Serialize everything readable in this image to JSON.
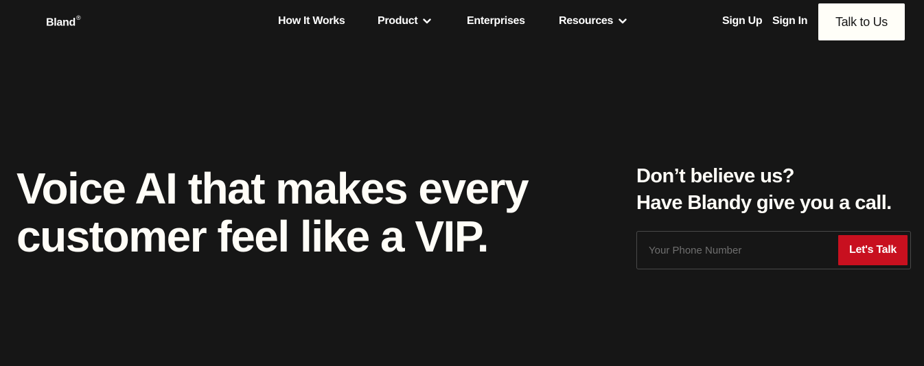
{
  "header": {
    "logo_text": "Bland",
    "logo_mark": "®",
    "nav": [
      {
        "label": "How It Works",
        "has_dropdown": false
      },
      {
        "label": "Product",
        "has_dropdown": true
      },
      {
        "label": "Enterprises",
        "has_dropdown": false
      },
      {
        "label": "Resources",
        "has_dropdown": true
      }
    ],
    "sign_up": "Sign Up",
    "sign_in": "Sign In",
    "cta": "Talk to Us"
  },
  "hero": {
    "title_line1": "Voice AI that makes every",
    "title_line2": "customer feel like a VIP."
  },
  "callout": {
    "line1": "Don’t believe us?",
    "line2": "Have Blandy give you a call.",
    "input_placeholder": "Your Phone Number",
    "input_value": "",
    "button_label": "Let's Talk"
  },
  "icons": {
    "dropdown": "chevron-down-icon"
  },
  "colors": {
    "background": "#161616",
    "text": "#fffdf7",
    "cta_background": "#fffef8",
    "accent_red": "#c8101f"
  }
}
